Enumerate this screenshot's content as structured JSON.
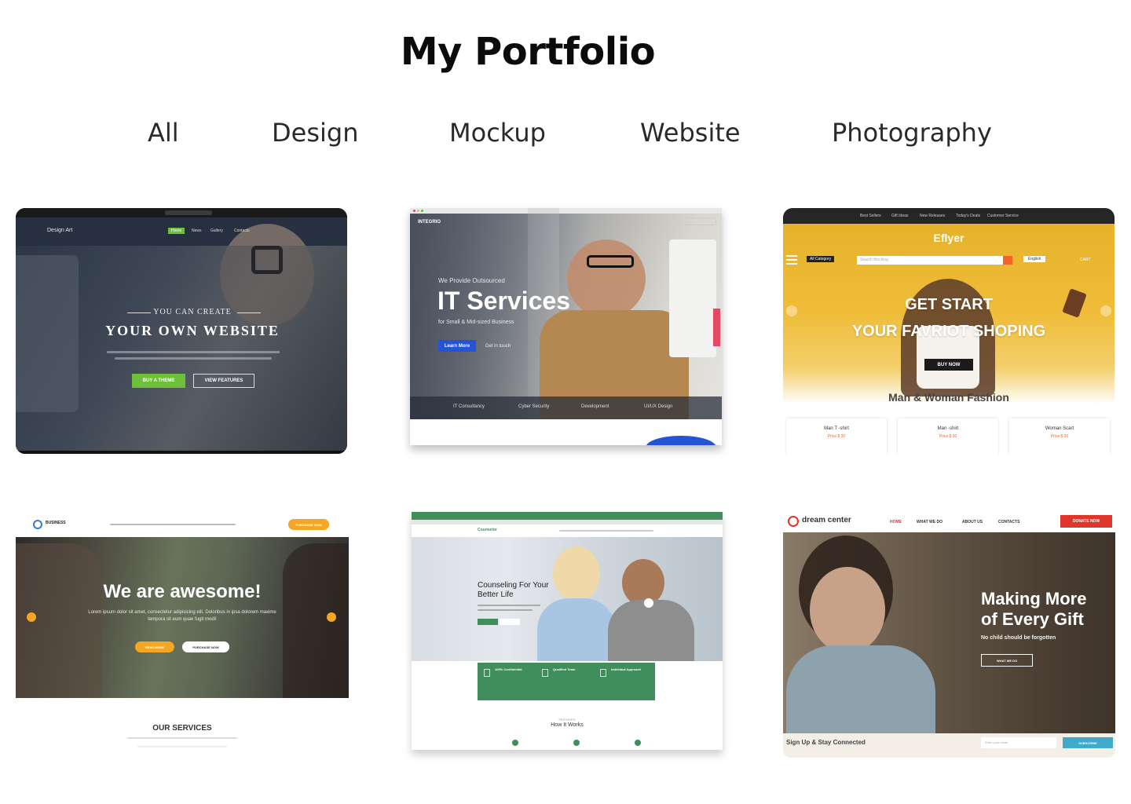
{
  "page": {
    "title": "My Portfolio"
  },
  "filters": [
    "All",
    "Design",
    "Mockup",
    "Website",
    "Photography"
  ],
  "colors": {
    "accent_green": "#6ec03a",
    "it_blue": "#2453d6",
    "effyer_yellow": "#e9b730",
    "awesome_orange": "#f5a623",
    "counsel_green": "#3f8e5b",
    "donate_red": "#e0352b",
    "subscribe_teal": "#41a9c9"
  },
  "cards": {
    "design_art": {
      "brand": "Design Art",
      "nav": [
        "Home",
        "News",
        "Gallery",
        "Contacts"
      ],
      "kicker": "YOU CAN CREATE",
      "headline": "YOUR OWN WEBSITE",
      "btn_primary": "BUY A THEME",
      "btn_secondary": "VIEW FEATURES"
    },
    "integrio": {
      "brand": "INTEGRIO",
      "kicker": "We Provide Outsourced",
      "headline": "IT Services",
      "sub": "for Small & Mid-sized Business",
      "btn_primary": "Learn More",
      "btn_secondary": "Get in touch",
      "features": [
        "IT Consultancy",
        "Cyber Security",
        "Development",
        "UI/UX Design"
      ]
    },
    "effyer": {
      "topnav": [
        "Best Sellers",
        "Gift Ideas",
        "New Releases",
        "Today's Deals",
        "Customer Service"
      ],
      "brand": "Eflyer",
      "category": "All Category",
      "search_placeholder": "Search this blog",
      "language": "English",
      "cart": "CART",
      "headline1": "GET START",
      "headline2": "YOUR FAVRIOT SHOPING",
      "btn": "BUY NOW",
      "section": "Man & Woman Fashion",
      "products": [
        {
          "name": "Man T -shirt",
          "price": "Price $ 30"
        },
        {
          "name": "Man -shirt",
          "price": "Price $ 30"
        },
        {
          "name": "Woman Scart",
          "price": "Price $ 30"
        }
      ]
    },
    "business": {
      "brand": "BUSINESS",
      "headline": "We are awesome!",
      "body": "Lorem ipsum dolor sit amet, consectetur adipisicing elit. Doloribus in ipsa dolorem maxime tempora sit eum quae fugit modi!",
      "btn_primary": "READ MORE",
      "btn_secondary": "PURCHASE NOW",
      "cta": "PURCHASE NOW",
      "section": "OUR SERVICES"
    },
    "counseling": {
      "brand": "Counselor",
      "headline": "Counseling For Your Better Life",
      "features": [
        "100% Confidential",
        "Qualified Team",
        "Individual Approach"
      ],
      "section_small": "FEATURES",
      "section": "How It Works"
    },
    "dream_center": {
      "brand": "dream center",
      "nav": [
        "HOME",
        "WHAT WE DO",
        "ABOUT US",
        "CONTACTS"
      ],
      "btn_donate": "DONATE NOW",
      "headline1": "Making More",
      "headline2": "of Every Gift",
      "sub": "No child should be forgotten",
      "btn": "WHAT WE DO",
      "footer": "Sign Up & Stay Connected",
      "email_placeholder": "Enter your email",
      "btn_subscribe": "SUBSCRIBE"
    }
  }
}
